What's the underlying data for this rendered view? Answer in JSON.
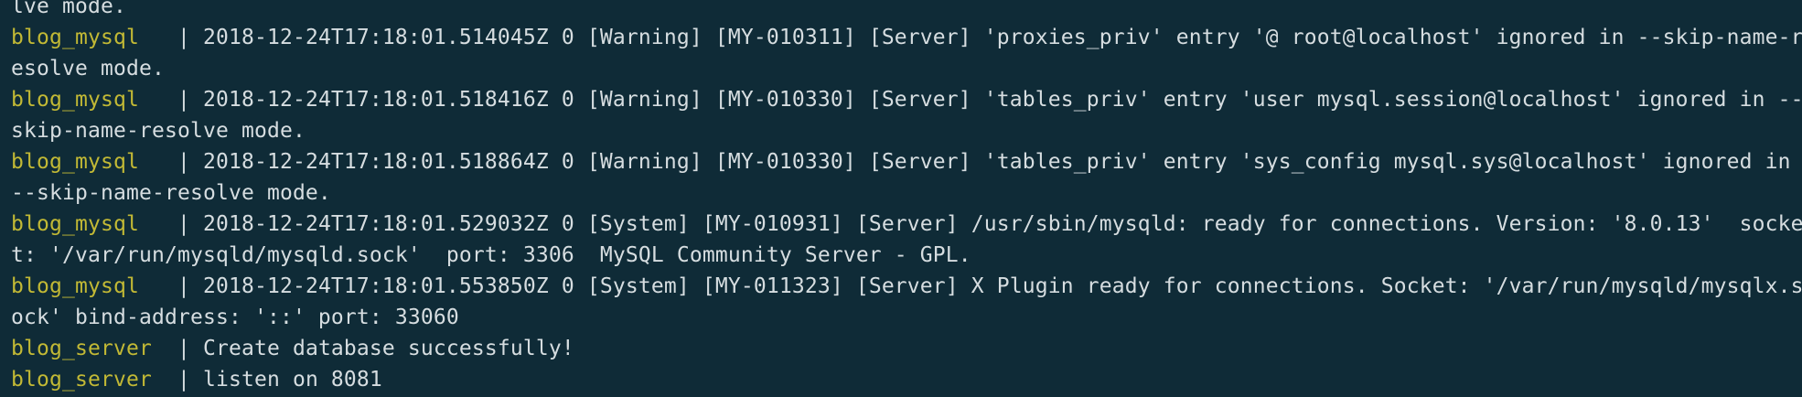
{
  "terminal": {
    "lines": [
      {
        "prefix": "",
        "text": "lve mode."
      },
      {
        "prefix": "blog_mysql   ",
        "text": "| 2018-12-24T17:18:01.514045Z 0 [Warning] [MY-010311] [Server] 'proxies_priv' entry '@ root@localhost' ignored in --skip-name-r"
      },
      {
        "prefix": "",
        "text": "esolve mode."
      },
      {
        "prefix": "blog_mysql   ",
        "text": "| 2018-12-24T17:18:01.518416Z 0 [Warning] [MY-010330] [Server] 'tables_priv' entry 'user mysql.session@localhost' ignored in --"
      },
      {
        "prefix": "",
        "text": "skip-name-resolve mode."
      },
      {
        "prefix": "blog_mysql   ",
        "text": "| 2018-12-24T17:18:01.518864Z 0 [Warning] [MY-010330] [Server] 'tables_priv' entry 'sys_config mysql.sys@localhost' ignored in"
      },
      {
        "prefix": "",
        "text": "--skip-name-resolve mode."
      },
      {
        "prefix": "blog_mysql   ",
        "text": "| 2018-12-24T17:18:01.529032Z 0 [System] [MY-010931] [Server] /usr/sbin/mysqld: ready for connections. Version: '8.0.13'  socke"
      },
      {
        "prefix": "",
        "text": "t: '/var/run/mysqld/mysqld.sock'  port: 3306  MySQL Community Server - GPL."
      },
      {
        "prefix": "blog_mysql   ",
        "text": "| 2018-12-24T17:18:01.553850Z 0 [System] [MY-011323] [Server] X Plugin ready for connections. Socket: '/var/run/mysqld/mysqlx.s"
      },
      {
        "prefix": "",
        "text": "ock' bind-address: '::' port: 33060"
      },
      {
        "prefix": "blog_server  ",
        "text": "| Create database successfully!"
      },
      {
        "prefix": "blog_server  ",
        "text": "| listen on 8081"
      }
    ]
  }
}
